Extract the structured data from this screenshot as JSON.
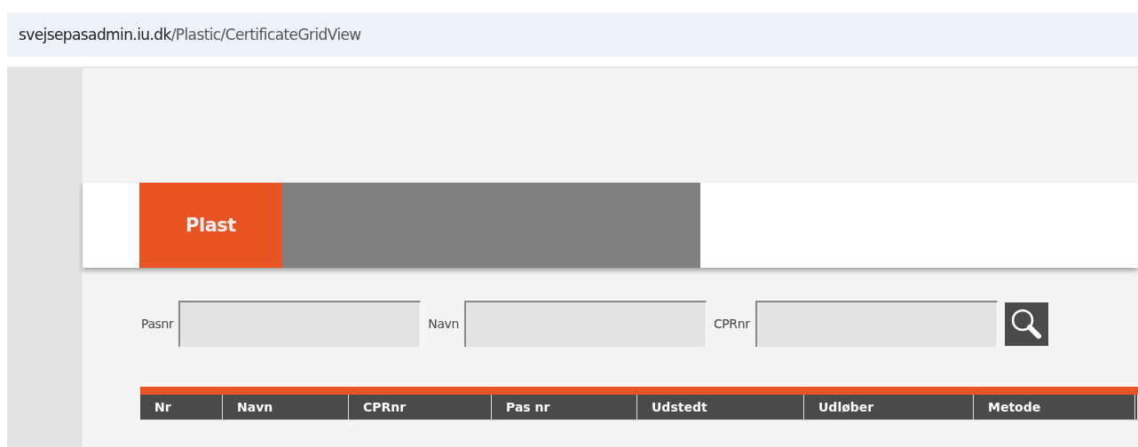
{
  "address_bar": {
    "domain": "svejsepasadmin.iu.dk",
    "path": "/Plastic/CertificateGridView"
  },
  "tabs": [
    {
      "label": "Plast",
      "selected": true
    }
  ],
  "search": {
    "fields": [
      {
        "label": "Pasnr"
      },
      {
        "label": "Navn"
      },
      {
        "label": "CPRnr"
      }
    ]
  },
  "table": {
    "columns": [
      "Nr",
      "Navn",
      "CPRnr",
      "Pas nr",
      "Udstedt",
      "Udløber",
      "Metode"
    ]
  }
}
